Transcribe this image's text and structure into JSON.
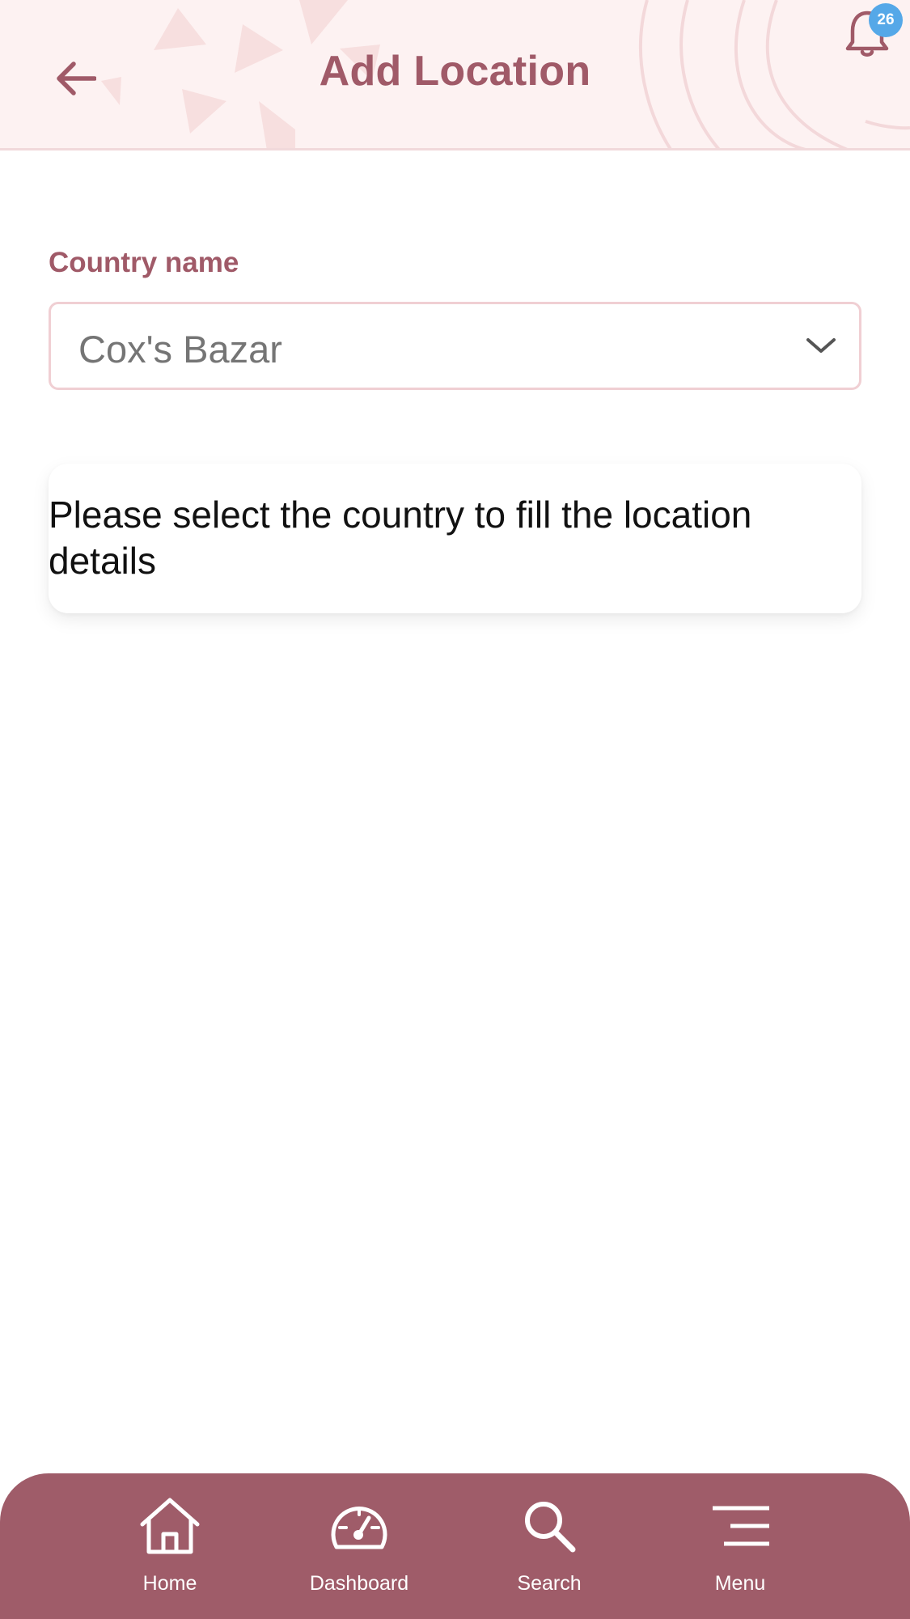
{
  "header": {
    "title": "Add Location",
    "notification_count": "26"
  },
  "form": {
    "country_label": "Country name",
    "country_value": "Cox's Bazar"
  },
  "info": {
    "message": "Please select the country to fill the location details"
  },
  "bottom_nav": {
    "items": [
      {
        "label": "Home",
        "icon": "home-icon"
      },
      {
        "label": "Dashboard",
        "icon": "dashboard-gauge-icon"
      },
      {
        "label": "Search",
        "icon": "search-icon"
      },
      {
        "label": "Menu",
        "icon": "menu-icon"
      }
    ]
  },
  "colors": {
    "accent": "#a05a68",
    "nav_background": "#9f5c69",
    "header_background": "#fdf2f2",
    "badge": "#55a8e8"
  }
}
